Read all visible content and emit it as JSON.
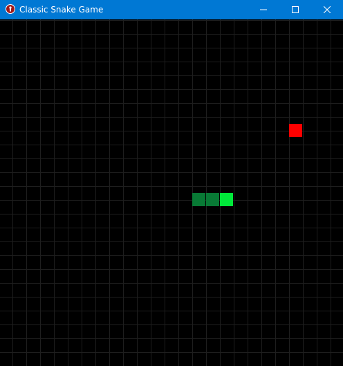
{
  "window": {
    "title": "Classic Snake Game",
    "titlebar_color": "#0078d4",
    "icon": "snake-app-icon",
    "controls": [
      "minimize-icon",
      "maximize-icon",
      "close-icon"
    ]
  },
  "game": {
    "background_color": "#000000",
    "grid_line_color": "#1e1e1e",
    "grid_visible": true,
    "snake": {
      "direction": "right",
      "head_color": "#00e83a",
      "body_color": "#087a35",
      "segments": [
        {
          "col": 14,
          "row": 12,
          "part": "body"
        },
        {
          "col": 15,
          "row": 12,
          "part": "body"
        },
        {
          "col": 16,
          "row": 12,
          "part": "head"
        }
      ]
    },
    "food": {
      "color": "#ff0000",
      "col": 21,
      "row": 7
    }
  }
}
